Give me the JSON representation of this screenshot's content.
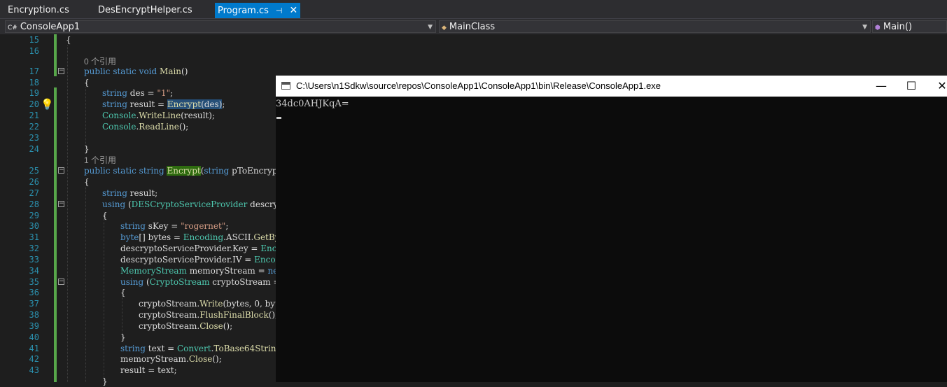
{
  "tabs": [
    {
      "label": "Encryption.cs"
    },
    {
      "label": "DesEncryptHelper.cs"
    },
    {
      "label": "Program.cs",
      "pin": "⊣",
      "close": "✕"
    }
  ],
  "navbar": {
    "project": "ConsoleApp1",
    "project_icon": "C#",
    "class": "MainClass",
    "member": "Main()"
  },
  "editor": {
    "ref_hint_0": "0 个引用",
    "ref_hint_1": "1 个引用",
    "lines": {
      "l15": "15",
      "l16": "16",
      "l17": "17",
      "l18": "18",
      "l19": "19",
      "l20": "20",
      "l21": "21",
      "l22": "22",
      "l23": "23",
      "l24": "24",
      "l25": "25",
      "l26": "26",
      "l27": "27",
      "l28": "28",
      "l29": "29",
      "l30": "30",
      "l31": "31",
      "l32": "32",
      "l33": "33",
      "l34": "34",
      "l35": "35",
      "l36": "36",
      "l37": "37",
      "l38": "38",
      "l39": "39",
      "l40": "40",
      "l41": "41",
      "l42": "42",
      "l43": "43"
    }
  },
  "console": {
    "title": "C:\\Users\\n1Sdkw\\source\\repos\\ConsoleApp1\\ConsoleApp1\\bin\\Release\\ConsoleApp1.exe",
    "output": "34dc0AHJKqA=",
    "minimize": "—",
    "maximize": "☐",
    "close": "✕"
  }
}
